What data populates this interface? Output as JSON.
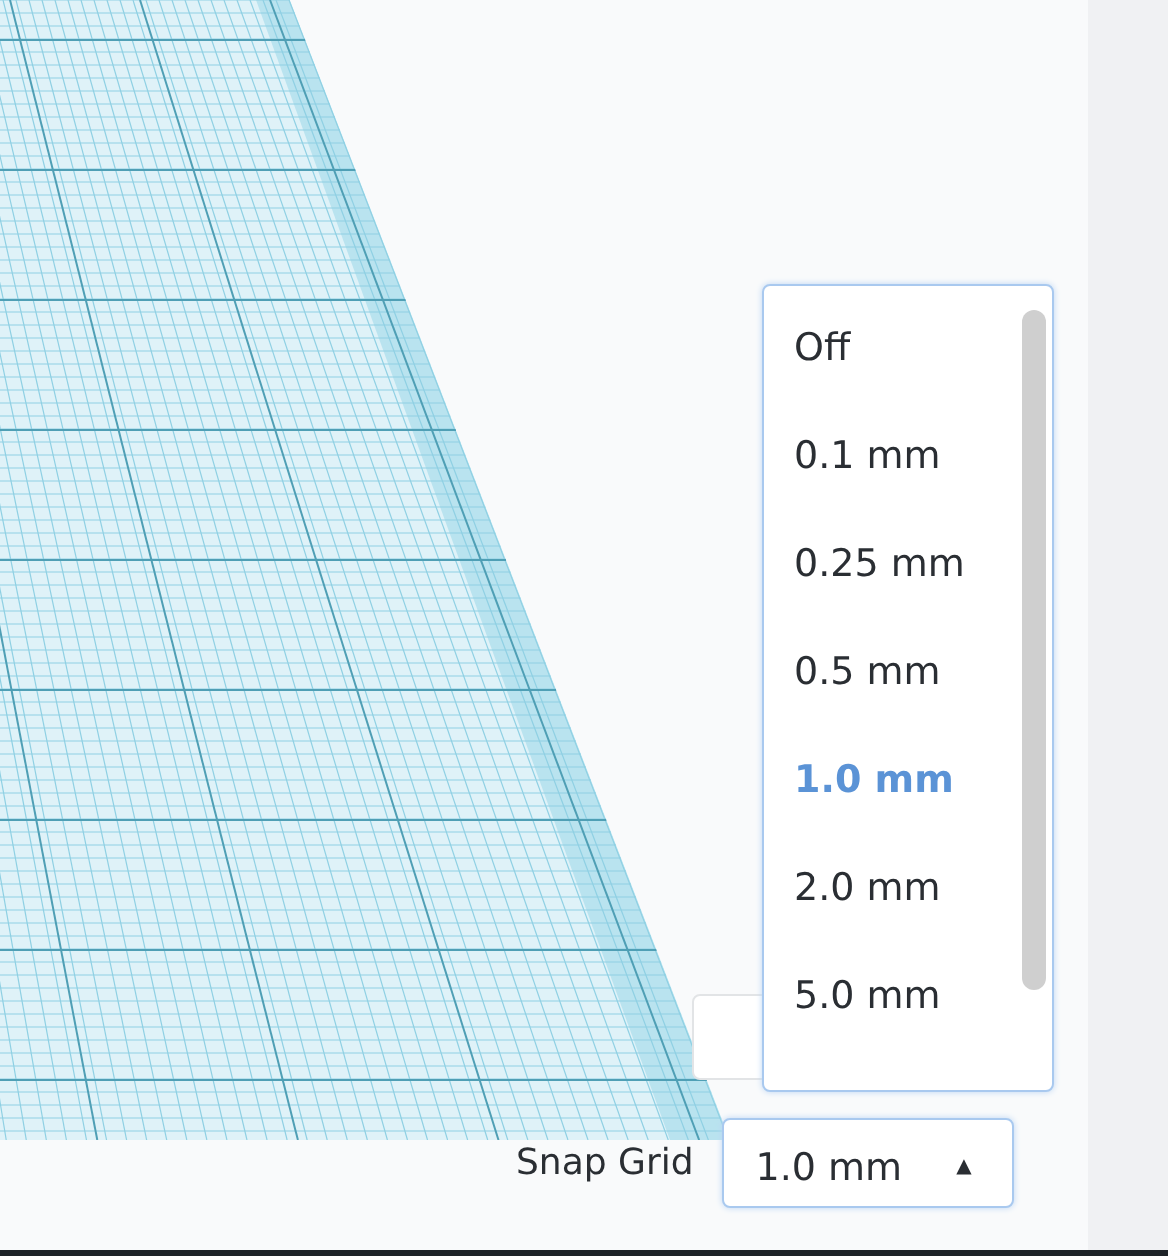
{
  "snap_grid": {
    "label": "Snap Grid",
    "value": "1.0 mm",
    "caret": "▲",
    "expanded": true,
    "options": [
      {
        "label": "Off",
        "selected": false
      },
      {
        "label": "0.1 mm",
        "selected": false
      },
      {
        "label": "0.25 mm",
        "selected": false
      },
      {
        "label": "0.5 mm",
        "selected": false
      },
      {
        "label": "1.0 mm",
        "selected": true
      },
      {
        "label": "2.0 mm",
        "selected": false
      },
      {
        "label": "5.0 mm",
        "selected": false
      }
    ]
  }
}
